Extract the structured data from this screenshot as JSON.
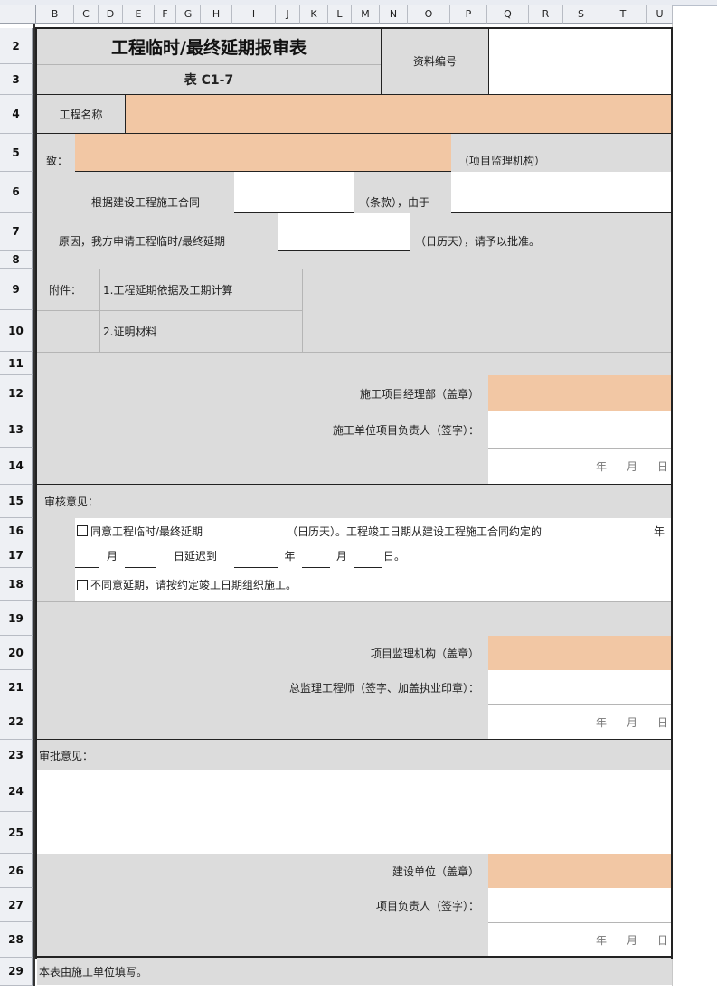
{
  "columns": [
    "B",
    "C",
    "D",
    "E",
    "F",
    "G",
    "H",
    "I",
    "J",
    "K",
    "L",
    "M",
    "N",
    "O",
    "P",
    "Q",
    "R",
    "S",
    "T",
    "U"
  ],
  "rows": [
    "2",
    "3",
    "4",
    "5",
    "6",
    "7",
    "8",
    "9",
    "10",
    "11",
    "12",
    "13",
    "14",
    "15",
    "16",
    "17",
    "18",
    "19",
    "20",
    "21",
    "22",
    "23",
    "24",
    "25",
    "26",
    "27",
    "28",
    "29"
  ],
  "form": {
    "title": "工程临时/最终延期报审表",
    "form_code": "表 C1-7",
    "archive_no_label": "资料编号",
    "project_name_label": "工程名称",
    "to_label": "致：",
    "supervisor_org_suffix": "（项目监理机构）",
    "contract_prefix": "根据建设工程施工合同",
    "clause_suffix": "（条款），由于",
    "reason_prefix": "原因，我方申请工程临时/最终延期",
    "days_suffix": "（日历天），请予以批准。",
    "attachment_label": "附件：",
    "attachment_1": "1.工程延期依据及工期计算",
    "attachment_2": "2.证明材料",
    "contractor_dept": "施工项目经理部（盖章）",
    "contractor_head": "施工单位项目负责人（签字）：",
    "date_y": "年",
    "date_m": "月",
    "date_d": "日",
    "review_label": "审核意见：",
    "agree_text": "同意工程临时/最终延期",
    "agree_mid": "（日历天）。工程竣工日期从建设工程施工合同约定的",
    "year": "年",
    "month": "月",
    "delay_to": "日延迟到",
    "day_end": "日。",
    "disagree_text": "不同意延期，请按约定竣工日期组织施工。",
    "supervisor_org": "项目监理机构（盖章）",
    "chief_engineer": "总监理工程师（签字、加盖执业印章）：",
    "approval_label": "审批意见：",
    "owner_unit": "建设单位（盖章）",
    "owner_head": "项目负责人（签字）：",
    "footnote": "本表由施工单位填写。"
  }
}
